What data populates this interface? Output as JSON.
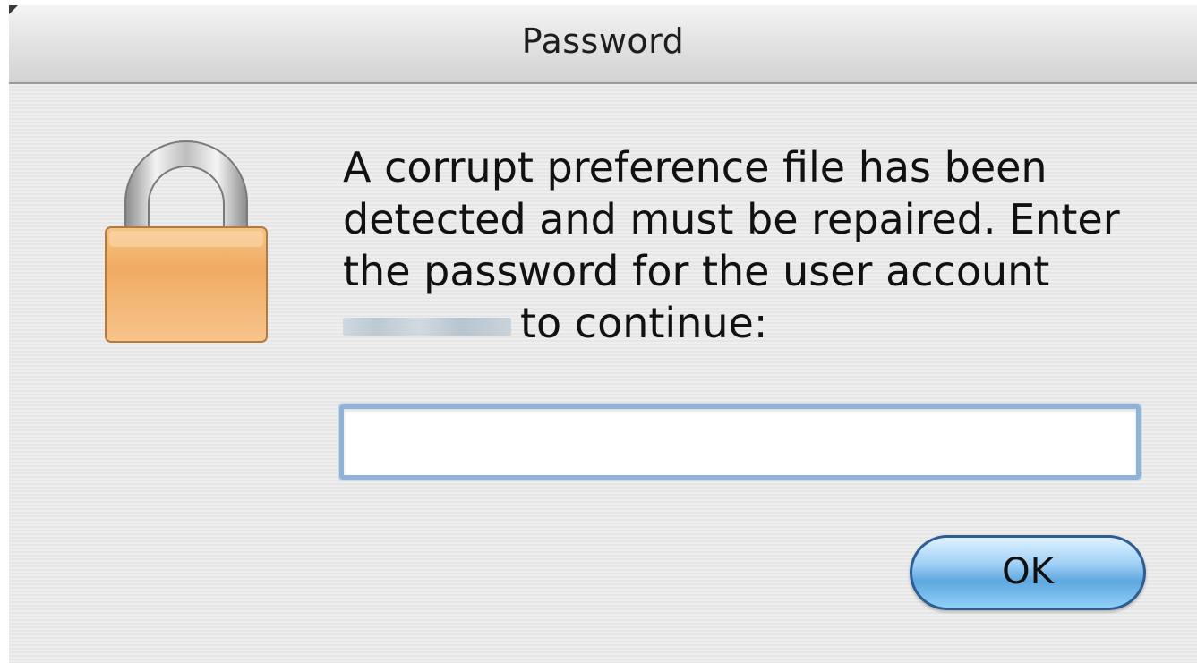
{
  "window": {
    "title": "Password"
  },
  "dialog": {
    "message_line_1": "A corrupt preference file has been",
    "message_line_2": "detected and must be repaired. Enter",
    "message_line_3": "the password for the user account",
    "message_line_4_suffix": "to continue:",
    "icon": "lock-icon"
  },
  "password_field": {
    "value": "",
    "placeholder": ""
  },
  "buttons": {
    "ok_label": "OK"
  },
  "colors": {
    "lock_body": "#f0a85a",
    "lock_shackle": "#b8b8b8",
    "button_blue": "#5ea7e0",
    "focus_ring": "#8fb2d6"
  }
}
